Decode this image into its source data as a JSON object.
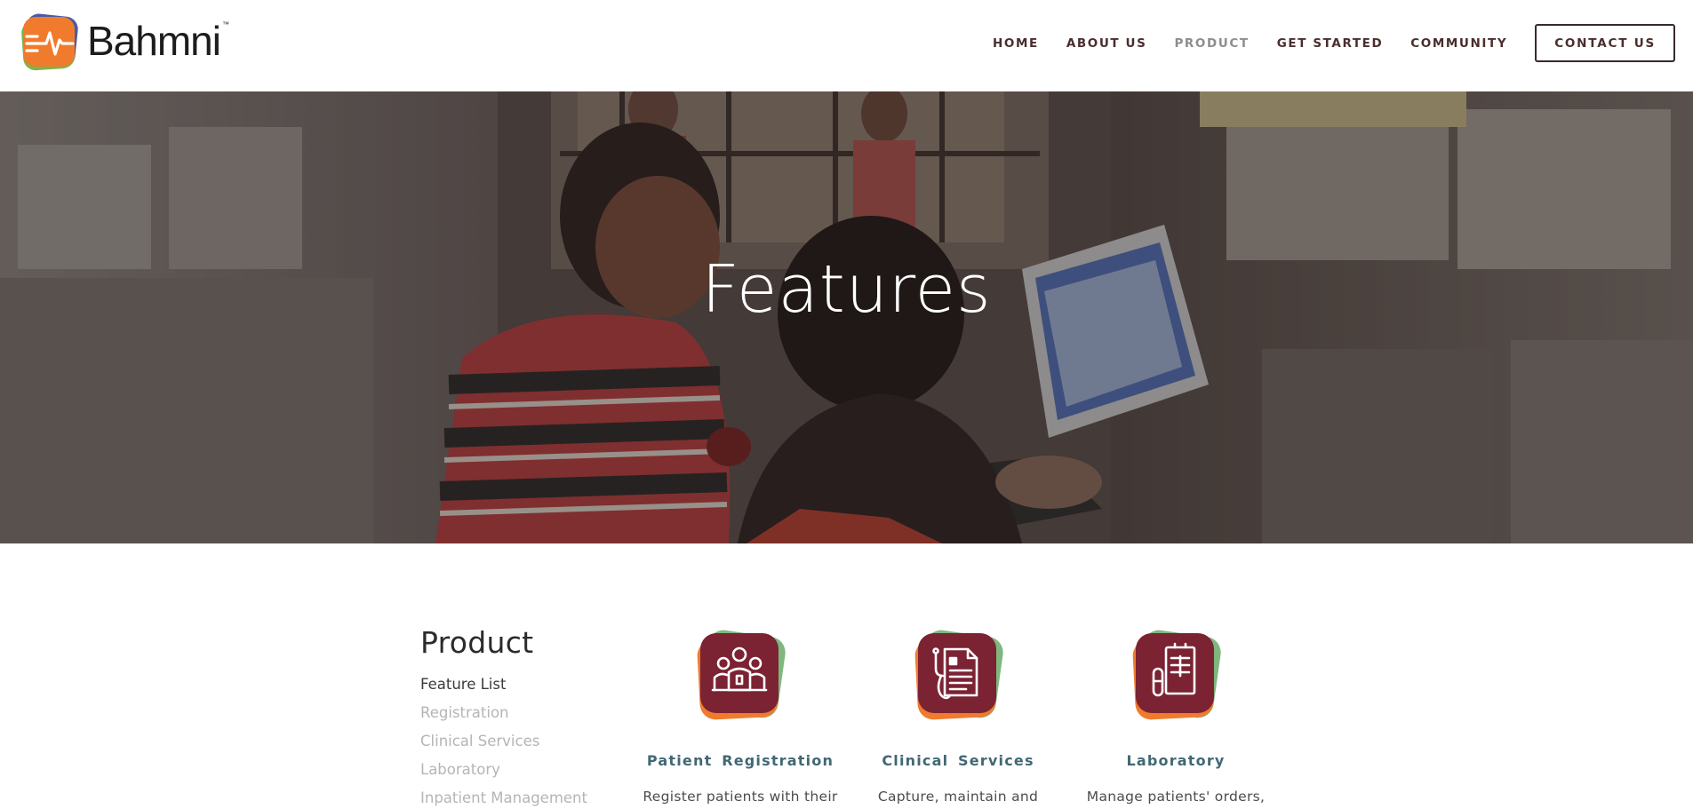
{
  "brand": {
    "name": "Bahmni",
    "trademark": "™"
  },
  "nav": {
    "items": [
      {
        "label": "HOME",
        "active": false
      },
      {
        "label": "ABOUT US",
        "active": false
      },
      {
        "label": "PRODUCT",
        "active": true
      },
      {
        "label": "GET STARTED",
        "active": false
      },
      {
        "label": "COMMUNITY",
        "active": false
      }
    ],
    "contact_label": "CONTACT US"
  },
  "hero": {
    "title": "Features"
  },
  "sidebar": {
    "title": "Product",
    "links": [
      {
        "label": "Feature List",
        "current": true
      },
      {
        "label": "Registration",
        "current": false
      },
      {
        "label": "Clinical Services",
        "current": false
      },
      {
        "label": "Laboratory",
        "current": false
      },
      {
        "label": "Inpatient Management",
        "current": false
      }
    ]
  },
  "features": [
    {
      "title": "Patient  Registration",
      "description": "Register patients with their",
      "icon": "patients-group-icon"
    },
    {
      "title": "Clinical  Services",
      "description": "Capture, maintain and",
      "icon": "stethoscope-document-icon"
    },
    {
      "title": "Laboratory",
      "description": "Manage patients' orders,",
      "icon": "lab-report-icon"
    }
  ],
  "colors": {
    "nav_text": "#4a2e2e",
    "nav_active": "#8d8d8d",
    "feature_title": "#416874",
    "icon_base": "#7b2233",
    "icon_green": "#7fb77e",
    "icon_orange": "#f07b2d"
  }
}
